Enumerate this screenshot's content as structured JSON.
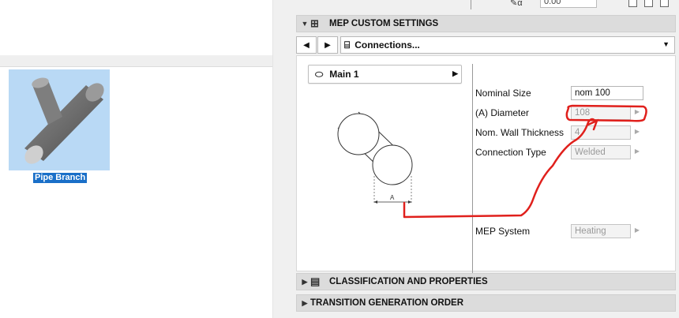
{
  "top_strip": {
    "field_value": "0.00"
  },
  "library": {
    "item_label": "Pipe Branch"
  },
  "sections": {
    "mep": {
      "title": "MEP CUSTOM SETTINGS"
    },
    "classification": {
      "title": "CLASSIFICATION AND PROPERTIES"
    },
    "transition": {
      "title": "TRANSITION GENERATION ORDER"
    }
  },
  "nav": {
    "prev": "◀",
    "next": "▶",
    "selected": "Connections..."
  },
  "connection": {
    "selector": "Main 1"
  },
  "diagram": {
    "dimension_label": "A"
  },
  "params": [
    {
      "label": "Nominal Size",
      "value": "nom 100"
    },
    {
      "label": "(A) Diameter",
      "value": "108"
    },
    {
      "label": "Nom. Wall Thickness",
      "value": "4"
    },
    {
      "label": "Connection Type",
      "value": "Welded"
    },
    {
      "label": "MEP System",
      "value": "Heating"
    }
  ],
  "colors": {
    "selection": "#1a6fc8",
    "annotation": "#e0201c",
    "tile": "#b9d9f5"
  }
}
